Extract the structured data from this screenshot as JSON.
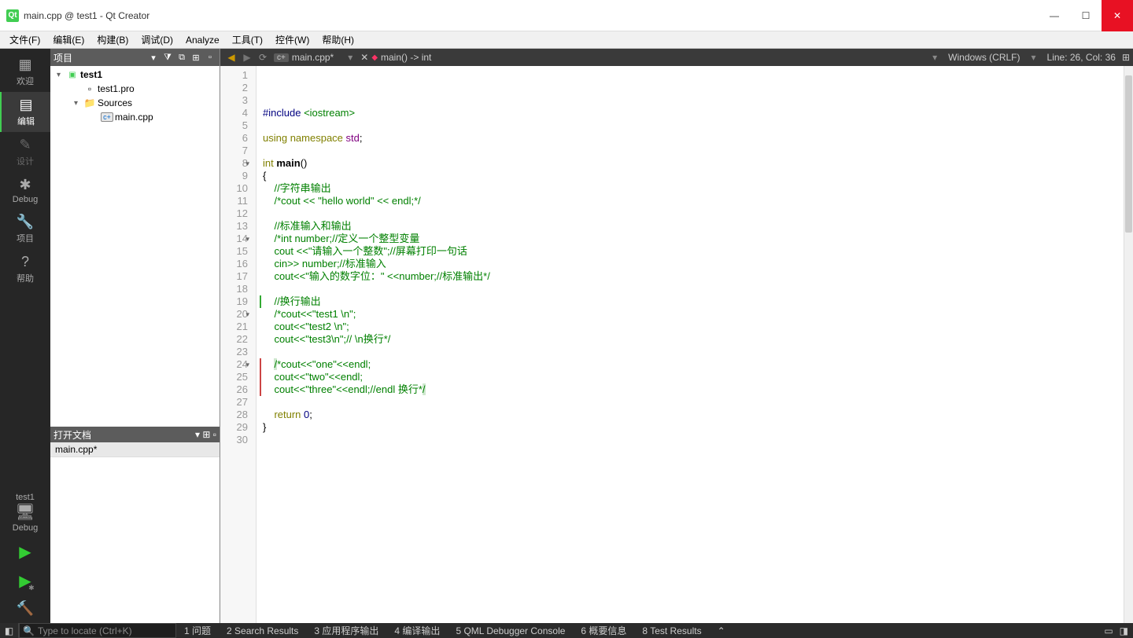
{
  "window": {
    "title": "main.cpp @ test1 - Qt Creator"
  },
  "menu": {
    "file": "文件(F)",
    "edit": "编辑(E)",
    "build": "构建(B)",
    "debug": "调试(D)",
    "analyze": "Analyze",
    "tools": "工具(T)",
    "widgets": "控件(W)",
    "help": "帮助(H)"
  },
  "activity": {
    "welcome": "欢迎",
    "edit": "编辑",
    "design": "设计",
    "debug": "Debug",
    "projects": "项目",
    "help": "帮助",
    "project_name": "test1",
    "debug_label": "Debug"
  },
  "project_panel": {
    "title": "项目",
    "tree": {
      "root": "test1",
      "pro": "test1.pro",
      "sources": "Sources",
      "main_cpp": "main.cpp"
    }
  },
  "open_docs": {
    "title": "打开文档",
    "items": [
      "main.cpp*"
    ]
  },
  "editor": {
    "filename": "main.cpp*",
    "func_sig": "main() -> int",
    "encoding": "Windows (CRLF)",
    "cursor": "Line: 26, Col: 36",
    "code": [
      "",
      "",
      "",
      "#include <iostream>",
      "",
      "using namespace std;",
      "",
      "int main()",
      "{",
      "    //字符串输出",
      "    /*cout << \"hello world\" << endl;*/",
      "",
      "    //标准输入和输出",
      "    /*int number;//定义一个整型变量",
      "    cout <<\"请输入一个整数\";//屏幕打印一句话",
      "    cin>> number;//标准输入",
      "    cout<<\"输入的数字位：\" <<number;//标准输出*/",
      "",
      "    //换行输出",
      "    /*cout<<\"test1 \\n\";",
      "    cout<<\"test2 \\n\";",
      "    cout<<\"test3\\n\";// \\n换行*/",
      "",
      "    /*cout<<\"one\"<<endl;",
      "    cout<<\"two\"<<endl;",
      "    cout<<\"three\"<<endl;//endl 换行*/",
      "",
      "    return 0;",
      "}",
      ""
    ],
    "fold_lines": [
      8,
      14,
      20,
      24
    ],
    "edit_red_lines": [
      24,
      25,
      26
    ],
    "edit_green_lines": [
      19
    ]
  },
  "bottom": {
    "locator_placeholder": "Type to locate (Ctrl+K)",
    "panes": {
      "p1": "1  问题",
      "p2": "2  Search Results",
      "p3": "3  应用程序输出",
      "p4": "4  编译输出",
      "p5": "5  QML Debugger Console",
      "p6": "6  概要信息",
      "p8": "8  Test Results"
    }
  }
}
